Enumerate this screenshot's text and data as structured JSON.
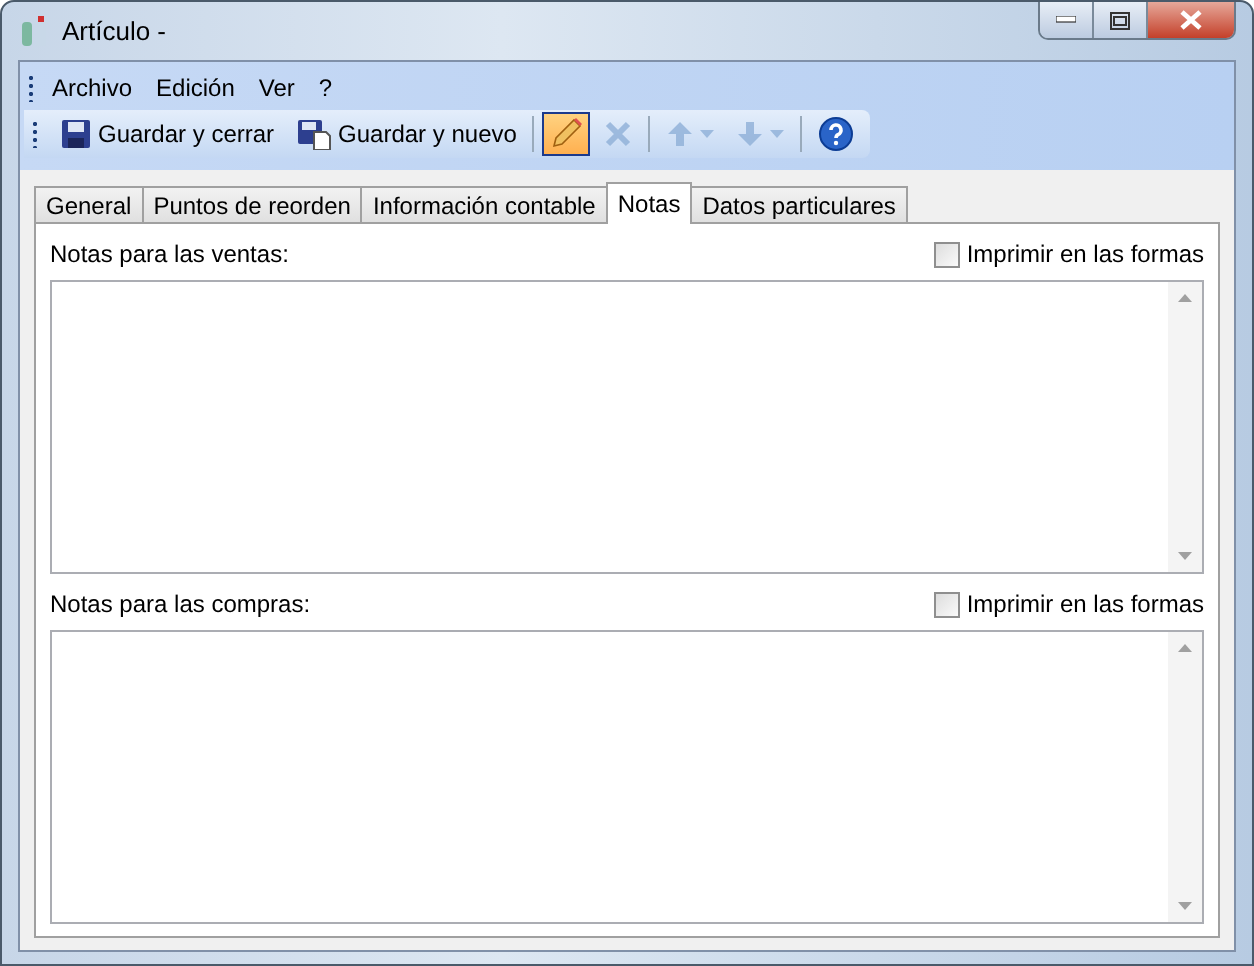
{
  "window": {
    "title": "Artículo -"
  },
  "menu": [
    {
      "label": "Archivo"
    },
    {
      "label": "Edición"
    },
    {
      "label": "Ver"
    },
    {
      "label": "?"
    }
  ],
  "toolbar": [
    {
      "kind": "save",
      "label": "Guardar y cerrar",
      "disabled": false,
      "pressed": false
    },
    {
      "kind": "save-new",
      "label": "Guardar y nuevo",
      "disabled": false,
      "pressed": false
    },
    {
      "kind": "edit",
      "disabled": false,
      "pressed": true
    },
    {
      "kind": "delete",
      "disabled": true,
      "pressed": false
    },
    {
      "kind": "up",
      "disabled": true,
      "pressed": false
    },
    {
      "kind": "down",
      "disabled": true,
      "pressed": false
    },
    {
      "kind": "help",
      "disabled": false,
      "pressed": false
    }
  ],
  "tabs": [
    {
      "label": "General",
      "selected": false
    },
    {
      "label": "Puntos de reorden",
      "selected": false
    },
    {
      "label": "Información contable",
      "selected": false
    },
    {
      "label": "Notas",
      "selected": true
    },
    {
      "label": "Datos particulares",
      "selected": false
    }
  ],
  "sections": [
    {
      "label": "Notas para las ventas:",
      "print_checkbox": {
        "label": "Imprimir en las formas",
        "checked": false
      }
    },
    {
      "label": "Notas para las compras:",
      "print_checkbox": {
        "label": "Imprimir en las formas",
        "checked": false
      }
    }
  ]
}
